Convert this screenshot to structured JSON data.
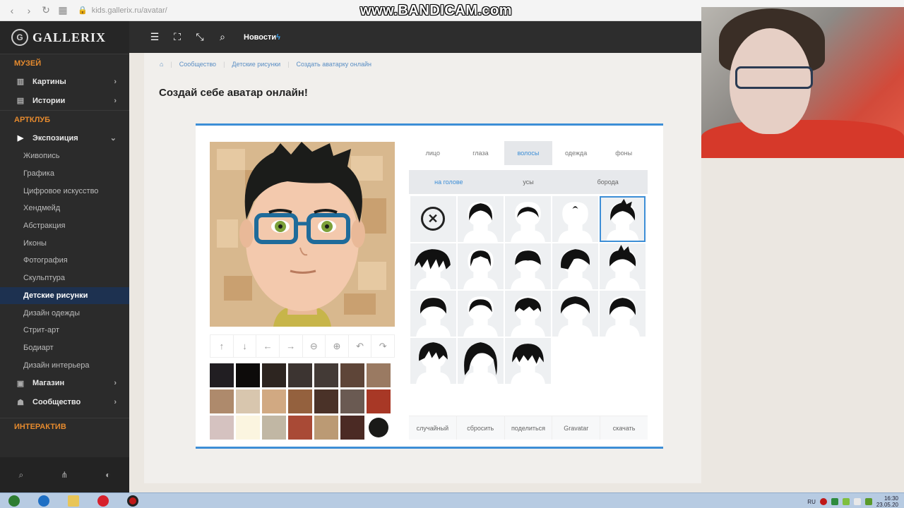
{
  "browser": {
    "url": "kids.gallerix.ru/avatar/"
  },
  "watermark": "www.BANDICAM.com",
  "sidebar": {
    "logo": "GALLERIX",
    "museum_title": "МУЗЕЙ",
    "museum_items": [
      {
        "label": "Картины",
        "icon": "museum-icon"
      },
      {
        "label": "Истории",
        "icon": "book-icon"
      }
    ],
    "artclub_title": "АРТКЛУБ",
    "exposition_label": "Экспозиция",
    "sub_items": [
      "Живопись",
      "Графика",
      "Цифровое искусство",
      "Хендмейд",
      "Абстракция",
      "Иконы",
      "Фотография",
      "Скульптура",
      "Детские рисунки",
      "Дизайн одежды",
      "Стрит-арт",
      "Бодиарт",
      "Дизайн интерьера"
    ],
    "active_sub_item": "Детские рисунки",
    "bottom_items": [
      {
        "label": "Магазин",
        "icon": "cart-icon"
      },
      {
        "label": "Сообщество",
        "icon": "users-icon"
      }
    ],
    "interactive_title": "ИНТЕРАКТИВ"
  },
  "topbar": {
    "news_label": "Новости"
  },
  "breadcrumb": [
    "Сообщество",
    "Детские рисунки",
    "Создать аватарку онлайн"
  ],
  "page_title": "Создай себе аватар онлайн!",
  "tabs": [
    "лицо",
    "глаза",
    "волосы",
    "одежда",
    "фоны"
  ],
  "active_tab": "волосы",
  "subtabs": [
    "на голове",
    "усы",
    "борода"
  ],
  "active_subtab": "на голове",
  "palette": [
    "#211e22",
    "#0d0b0a",
    "#2d2520",
    "#3c3431",
    "#433a36",
    "#5e4538",
    "#9a7a62",
    "#ae8a6c",
    "#d8c6ae",
    "#d1a982",
    "#94613e",
    "#4a3228",
    "#6a5a52",
    "#a83826",
    "#d5c2c0",
    "#fbf5e0",
    "#c1b7a4",
    "#a94a36",
    "#bb9a74",
    "#4b2a24",
    "#1a1a18"
  ],
  "actions": [
    "случайный",
    "сбросить",
    "поделиться",
    "Gravatar",
    "скачать"
  ],
  "tray": {
    "lang": "RU",
    "time": "16:30",
    "date": "23.05.20"
  },
  "colors": {
    "accent": "#3d8ed6",
    "sidebar_bg": "#2b2b2b",
    "section_title": "#e58a2e"
  }
}
